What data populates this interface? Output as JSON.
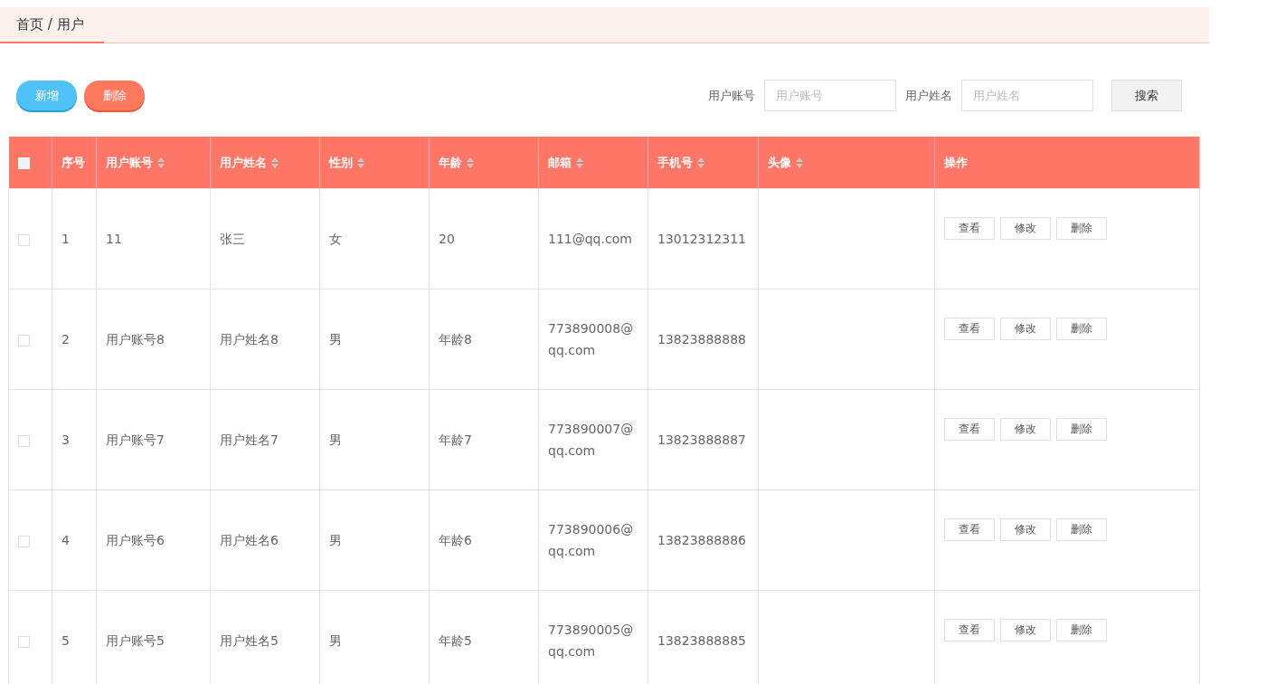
{
  "breadcrumb": {
    "label": "首页 / 用户",
    "selected": true
  },
  "actions": [
    {
      "label": "新增",
      "kind": "add"
    },
    {
      "label": "删除",
      "kind": "delete"
    }
  ],
  "search": {
    "fields": [
      {
        "label": "用户账号",
        "placeholder": "用户账号"
      },
      {
        "label": "用户姓名",
        "placeholder": "用户姓名"
      }
    ],
    "button": "搜索"
  },
  "table": {
    "select_all": {
      "checked": false
    },
    "columns": [
      {
        "label": "序号",
        "sortable": false
      },
      {
        "label": "用户账号",
        "sortable": true
      },
      {
        "label": "用户姓名",
        "sortable": true
      },
      {
        "label": "性别",
        "sortable": true
      },
      {
        "label": "年龄",
        "sortable": true
      },
      {
        "label": "邮箱",
        "sortable": true
      },
      {
        "label": "手机号",
        "sortable": true
      },
      {
        "label": "头像",
        "sortable": true
      },
      {
        "label": "操作",
        "sortable": false
      }
    ],
    "rows": [
      {
        "checked": false,
        "cells": [
          "1",
          "11",
          "张三",
          "女",
          "20",
          "111@qq.com",
          "13012312311"
        ],
        "actions": [
          "查看",
          "修改",
          "删除"
        ]
      },
      {
        "checked": false,
        "cells": [
          "2",
          "用户账号8",
          "用户姓名8",
          "男",
          "年龄8",
          "773890008@qq.com",
          "13823888888"
        ],
        "actions": [
          "查看",
          "修改",
          "删除"
        ]
      },
      {
        "checked": false,
        "cells": [
          "3",
          "用户账号7",
          "用户姓名7",
          "男",
          "年龄7",
          "773890007@qq.com",
          "13823888887"
        ],
        "actions": [
          "查看",
          "修改",
          "删除"
        ]
      },
      {
        "checked": false,
        "cells": [
          "4",
          "用户账号6",
          "用户姓名6",
          "男",
          "年龄6",
          "773890006@qq.com",
          "13823888886"
        ],
        "actions": [
          "查看",
          "修改",
          "删除"
        ]
      },
      {
        "checked": false,
        "cells": [
          "5",
          "用户账号5",
          "用户姓名5",
          "男",
          "年龄5",
          "773890005@qq.com",
          "13823888885"
        ],
        "actions": [
          "查看",
          "修改",
          "删除"
        ]
      }
    ]
  }
}
